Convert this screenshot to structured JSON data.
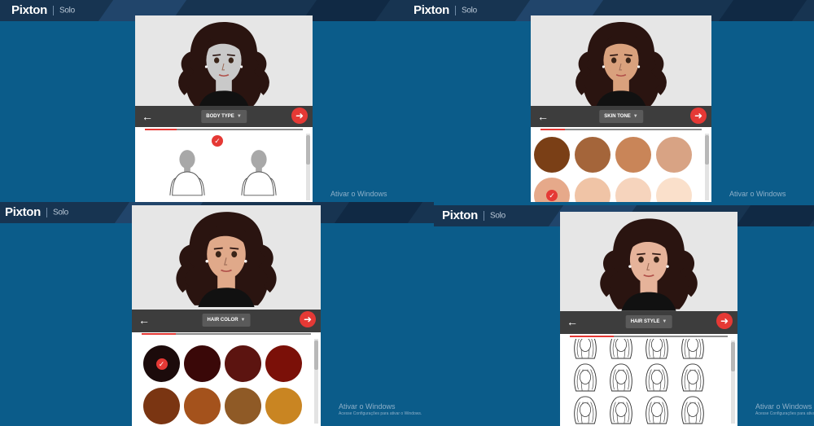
{
  "brand": {
    "logo": "Pixton",
    "plan": "Solo"
  },
  "watermark": {
    "line1": "Ativar o Windows",
    "line2": "Acesse Configurações para ativar o Windows."
  },
  "icons": {
    "back": "arrow-left-icon",
    "next": "arrow-right-icon",
    "dropdown": "chevron-down-icon",
    "selected": "checkmark-icon"
  },
  "colors": {
    "background": "#0b5c8a",
    "topbar": "#173451",
    "accent": "#e53935",
    "toolbar": "#3d3d3d"
  },
  "panes": [
    {
      "step_label": "BODY TYPE",
      "progress": 0.2,
      "options": [
        "body-type-1",
        "body-type-2"
      ],
      "selected_option": 0
    },
    {
      "step_label": "SKIN TONE",
      "progress": 0.15,
      "swatches": [
        "#7a3f16",
        "#a4653a",
        "#c98558",
        "#d8a384",
        "#e6a98a",
        "#f0c4a6",
        "#f6d4bd",
        "#fae0cb"
      ],
      "selected_swatch": 4
    },
    {
      "step_label": "HAIR COLOR",
      "progress": 0.2,
      "swatches": [
        "#1c0b0b",
        "#3a0808",
        "#5c1410",
        "#7b1008",
        "#7a3512",
        "#a4521c",
        "#8f5a26",
        "#c98522"
      ],
      "selected_swatch": 0
    },
    {
      "step_label": "HAIR STYLE",
      "progress": 0.28,
      "options": [
        "hair-style-1",
        "hair-style-2",
        "hair-style-3",
        "hair-style-4",
        "hair-style-5",
        "hair-style-6",
        "hair-style-7",
        "hair-style-8",
        "hair-style-9",
        "hair-style-10",
        "hair-style-11",
        "hair-style-12"
      ]
    }
  ]
}
